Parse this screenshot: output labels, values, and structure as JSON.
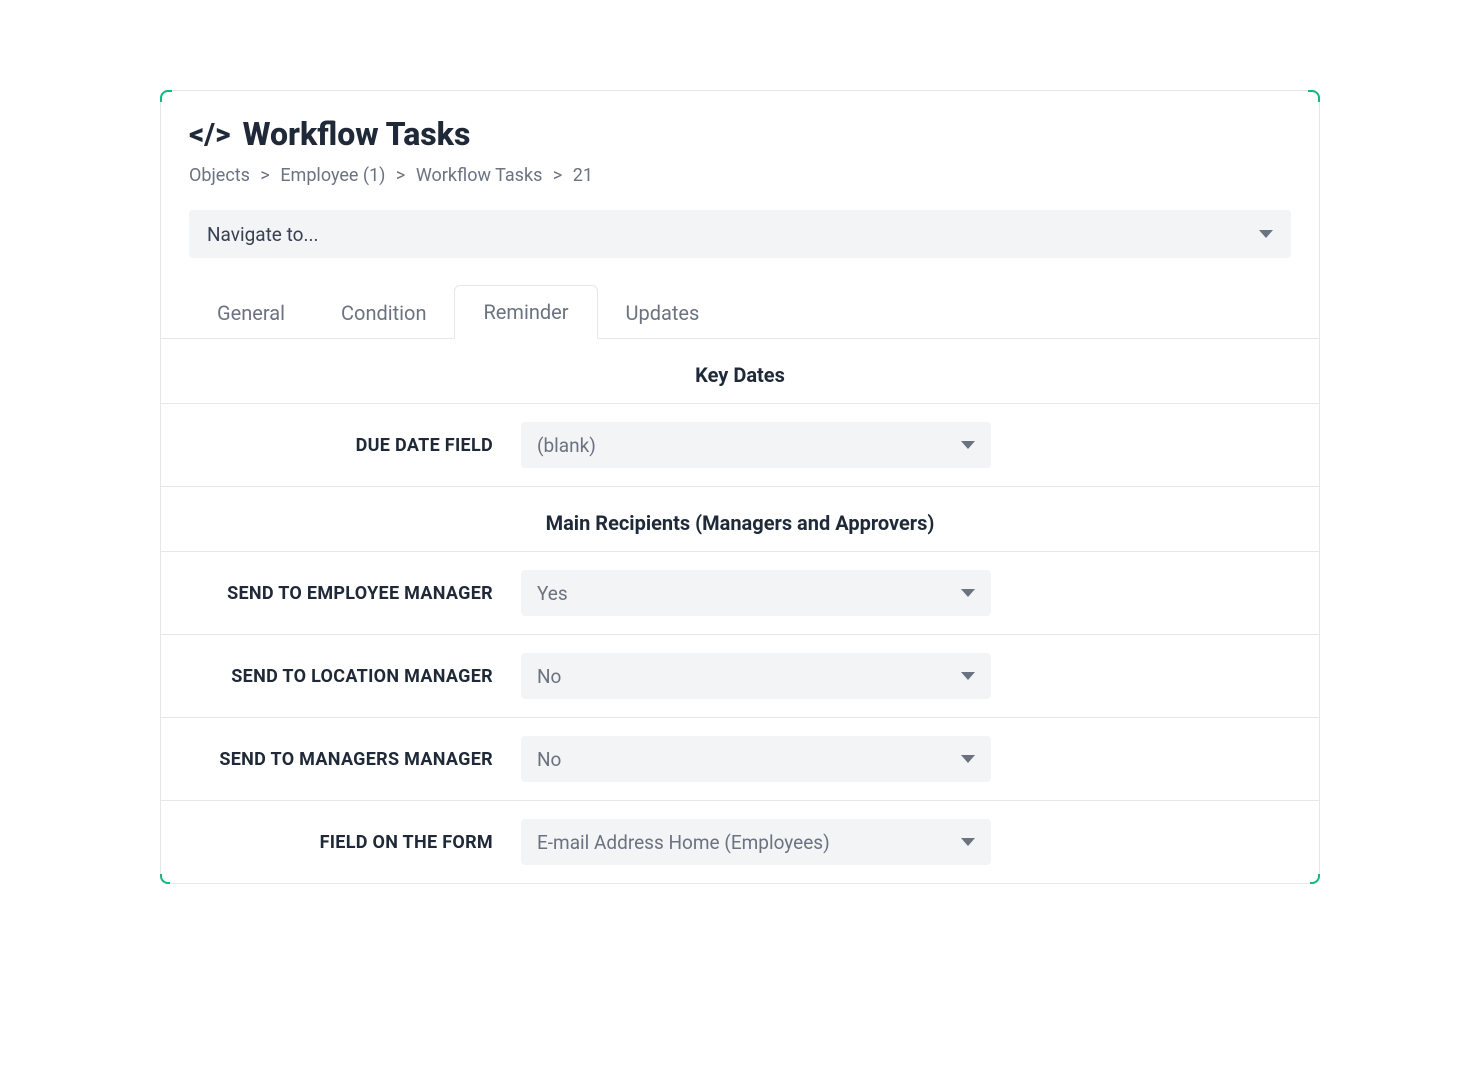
{
  "header": {
    "icon_glyph": "</>",
    "title": "Workflow Tasks"
  },
  "breadcrumbs": {
    "items": [
      {
        "label": "Objects"
      },
      {
        "label": "Employee (1)"
      },
      {
        "label": "Workflow Tasks"
      }
    ],
    "current": "21",
    "separator": ">"
  },
  "navigate": {
    "placeholder": "Navigate to..."
  },
  "tabs": [
    {
      "id": "general",
      "label": "General",
      "active": false
    },
    {
      "id": "condition",
      "label": "Condition",
      "active": false
    },
    {
      "id": "reminder",
      "label": "Reminder",
      "active": true
    },
    {
      "id": "updates",
      "label": "Updates",
      "active": false
    }
  ],
  "sections": {
    "key_dates": {
      "title": "Key Dates",
      "fields": {
        "due_date_field": {
          "label": "DUE DATE FIELD",
          "value": "(blank)"
        }
      }
    },
    "main_recipients": {
      "title": "Main Recipients (Managers and Approvers)",
      "fields": {
        "send_to_employee_manager": {
          "label": "SEND TO EMPLOYEE MANAGER",
          "value": "Yes"
        },
        "send_to_location_manager": {
          "label": "SEND TO LOCATION MANAGER",
          "value": "No"
        },
        "send_to_managers_manager": {
          "label": "SEND TO MANAGERS MANAGER",
          "value": "No"
        },
        "field_on_the_form": {
          "label": "FIELD ON THE FORM",
          "value": "E-mail Address Home (Employees)"
        }
      }
    }
  }
}
